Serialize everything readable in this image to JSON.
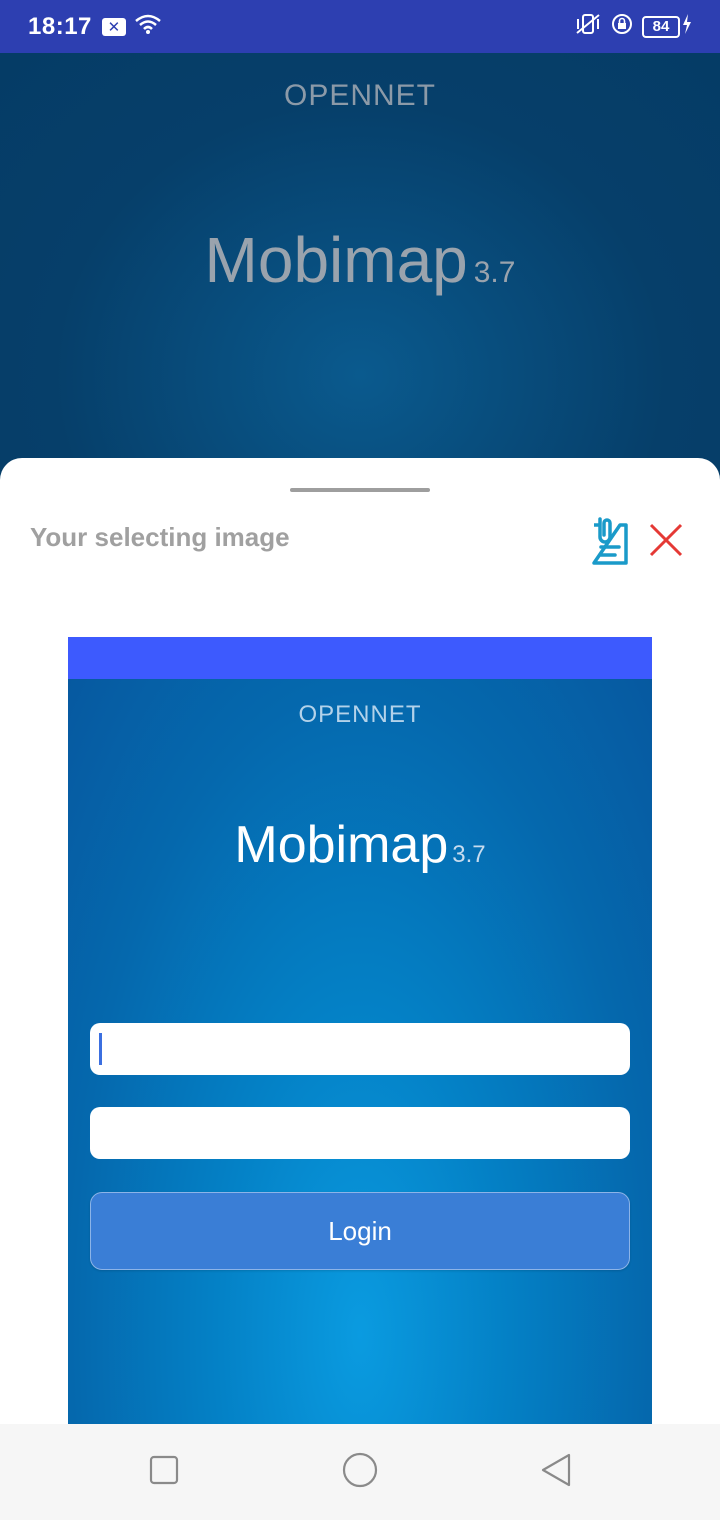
{
  "status": {
    "time": "18:17",
    "battery": "84"
  },
  "background_app": {
    "brand": "OPENNET",
    "app_name": "Mobimap",
    "version": "3.7"
  },
  "sheet": {
    "title": "Your selecting image",
    "attach_icon": "clipboard-icon",
    "close_icon": "close-icon",
    "accent_color": "#1a9ac9",
    "close_color": "#e53935"
  },
  "preview": {
    "brand": "OPENNET",
    "app_name": "Mobimap",
    "version": "3.7",
    "username_value": "",
    "password_value": "",
    "login_label": "Login",
    "statusbar_color": "#3d5afe"
  },
  "nav": {
    "recents_icon": "square-icon",
    "home_icon": "circle-icon",
    "back_icon": "triangle-back-icon"
  }
}
